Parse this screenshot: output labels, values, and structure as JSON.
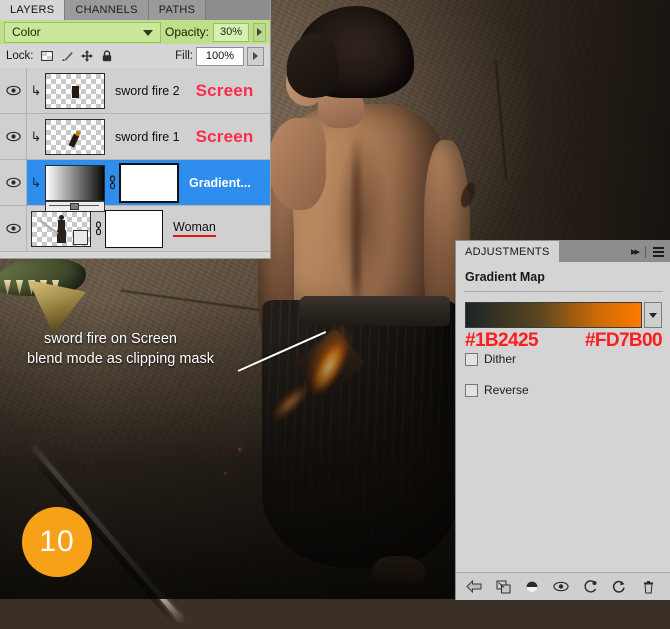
{
  "layers_panel": {
    "tabs": [
      {
        "label": "LAYERS",
        "active": true
      },
      {
        "label": "CHANNELS",
        "active": false
      },
      {
        "label": "PATHS",
        "active": false
      }
    ],
    "blend_mode": "Color",
    "opacity_label": "Opacity:",
    "opacity_value": "30%",
    "lock_label": "Lock:",
    "lock_icons": [
      "lock-transparency-icon",
      "lock-image-icon",
      "lock-position-icon",
      "lock-all-icon"
    ],
    "fill_label": "Fill:",
    "fill_value": "100%",
    "layers": [
      {
        "name": "sword fire 2",
        "blend_tag": "Screen",
        "visible": true,
        "clipped": true,
        "selected": false,
        "thumb_type": "transparent",
        "has_mask": false
      },
      {
        "name": "sword fire 1",
        "blend_tag": "Screen",
        "visible": true,
        "clipped": true,
        "selected": false,
        "thumb_type": "transparent",
        "has_mask": false
      },
      {
        "name": "Gradient...",
        "blend_tag": "",
        "visible": true,
        "clipped": true,
        "selected": true,
        "thumb_type": "gradient",
        "has_mask": true
      },
      {
        "name": "Woman",
        "blend_tag": "",
        "visible": true,
        "clipped": false,
        "selected": false,
        "thumb_type": "transparent",
        "has_mask": true,
        "underlined": true
      }
    ]
  },
  "adjustments_panel": {
    "tab_label": "ADJUSTMENTS",
    "title": "Gradient Map",
    "gradient": {
      "start_hex": "#1B2425",
      "end_hex": "#FD7B00"
    },
    "checkboxes": [
      {
        "label": "Dither",
        "checked": false
      },
      {
        "label": "Reverse",
        "checked": false
      }
    ],
    "footer_icons": [
      "back-arrow-icon",
      "clip-to-layer-icon",
      "mask-toggle-icon",
      "preview-eye-icon",
      "previous-state-icon",
      "reset-icon",
      "delete-icon"
    ]
  },
  "annotations": {
    "callout_line1": "sword fire on Screen",
    "callout_line2": "blend mode as clipping mask",
    "step_badge": "10"
  },
  "colors": {
    "selection_blue": "#2f8ded",
    "blend_row_green": "#bfe08a",
    "annotation_red": "#ff1d1d",
    "screen_tag_red": "#ff2b4a",
    "badge_orange": "#f7a118"
  }
}
